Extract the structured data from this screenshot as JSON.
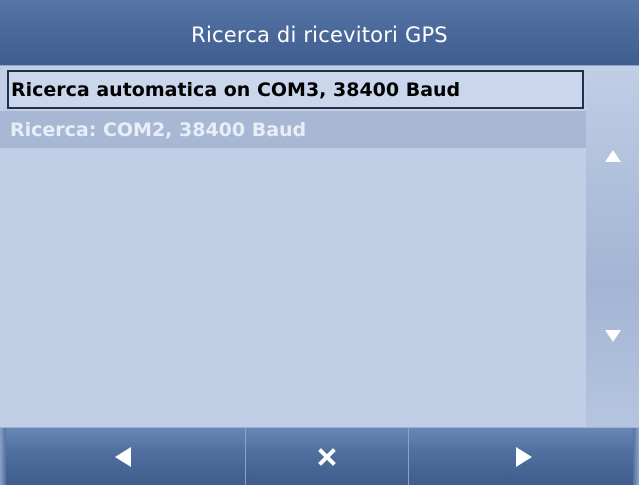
{
  "header": {
    "title": "Ricerca di ricevitori GPS"
  },
  "list": {
    "items": [
      {
        "label": "Ricerca automatica on COM3, 38400 Baud",
        "state": "selected"
      },
      {
        "label": "Ricerca: COM2, 38400 Baud",
        "state": "disabled"
      }
    ]
  },
  "scrollbar": {
    "up_icon": "triangle-up-icon",
    "down_icon": "triangle-down-icon"
  },
  "toolbar": {
    "back_icon": "triangle-left-icon",
    "cancel_icon": "x-icon",
    "next_icon": "triangle-right-icon"
  },
  "colors": {
    "header_bg": "#4b6a9b",
    "list_bg": "#c0cfe6",
    "selected_border": "#22304a",
    "disabled_row_bg": "#a7b7d4",
    "toolbar_bg": "#52709f"
  }
}
